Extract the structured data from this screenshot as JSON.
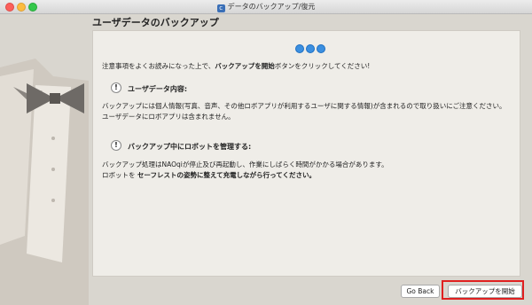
{
  "window": {
    "title": "データのバックアップ/復元",
    "app_icon_glyph": "c"
  },
  "page": {
    "heading": "ユーザデータのバックアップ"
  },
  "content": {
    "intro_prefix": "注意事項をよくお読みになった上で、",
    "intro_bold": "バックアップを開始",
    "intro_suffix": "ボタンをクリックしてください!",
    "section1": {
      "title": "ユーザデータ内容:",
      "line1": "バックアップには個人情報(写真、音声、その他ロボアプリが利用するユーザに関する情報)が含まれるので取り扱いにご注意ください。",
      "line2": "ユーザデータにロボアプリは含まれません。"
    },
    "section2": {
      "title": "バックアップ中にロボットを管理する:",
      "line1": "バックアップ処理はNAOqiが停止及び再起動し、作業にしばらく時間がかかる場合があります。",
      "line2_prefix": "ロボットを ",
      "line2_bold": "セーフレストの姿勢に整えて充電しながら行ってください。"
    },
    "warning_glyph": "!"
  },
  "footer": {
    "go_back_label": "Go Back",
    "start_backup_label": "バックアップを開始"
  },
  "colors": {
    "accent": "#3b8fe0",
    "highlight": "#e02020"
  },
  "icons": {
    "progress": "progress-dots-icon",
    "warning": "warning-icon"
  }
}
